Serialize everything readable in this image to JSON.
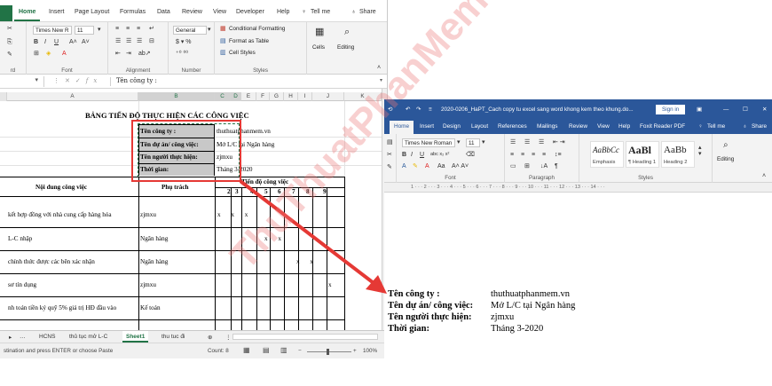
{
  "excel": {
    "tabs": [
      "Home",
      "Insert",
      "Page Layout",
      "Formulas",
      "Data",
      "Review",
      "View",
      "Developer",
      "Help"
    ],
    "tell_me": "Tell me",
    "share": "Share",
    "font_name": "Times New R",
    "font_size": "11",
    "number_format": "General",
    "groups": {
      "clipboard": "rd",
      "font": "Font",
      "alignment": "Alignment",
      "number": "Number",
      "styles": "Styles"
    },
    "styles_items": [
      "Conditional Formatting",
      "Format as Table",
      "Cell Styles"
    ],
    "cells_label": "Cells",
    "editing_label": "Editing",
    "formula_bar_text": "Tên công ty :",
    "columns": [
      "A",
      "B",
      "C",
      "D",
      "E",
      "F",
      "G",
      "H",
      "I",
      "J",
      "K"
    ],
    "sheet": {
      "title": "BẢNG TIẾN ĐỘ THỰC HIỆN CÁC CÔNG VIỆC",
      "info_labels": [
        "Tên công ty :",
        "Tên dự án/ công việc:",
        "Tên người thực hiện:",
        "Thời gian:"
      ],
      "info_values_visible": [
        "thuthuatphanmem.vn",
        "Mở L/C tại Ngân hàng",
        "zjmxu",
        "Tháng 3-2020"
      ],
      "header_content": "Nội dung công việc",
      "header_owner": "Phụ trách",
      "header_progress": "Tiến độ công việc",
      "progress_cols": [
        "2",
        "3",
        "4",
        "5",
        "6",
        "7",
        "8",
        "9"
      ],
      "rows": [
        {
          "task": "kết hợp đồng với nhà cung cấp hàng hóa",
          "owner": "zjmxu",
          "marks": "x x x"
        },
        {
          "task": "L-C  nhập",
          "owner": "Ngân hàng",
          "marks": "x x"
        },
        {
          "task": "chính thức được các bên xác nhận",
          "owner": "Ngân hàng",
          "marks": "x x"
        },
        {
          "task": "sơ tín dụng",
          "owner": "zjmxu",
          "marks": "x"
        },
        {
          "task": "nh toán tiền ký quỹ 5% giá trị HĐ đầu vào",
          "owner": "Kế toán",
          "marks": ""
        }
      ]
    },
    "sheet_tabs": [
      "HCNS",
      "thủ tục mở L-C",
      "Sheet1",
      "thu tuc đi"
    ],
    "status_text": "stination and press ENTER or choose Paste",
    "count_text": "Count: 8",
    "zoom": "100%"
  },
  "word": {
    "title": "2020-0206_HaPT_Cach copy tu excel sang word khong kem theo khung.do...",
    "sign_in": "Sign in",
    "tabs": [
      "Home",
      "Insert",
      "Design",
      "Layout",
      "References",
      "Mailings",
      "Review",
      "View",
      "Help",
      "Foxit Reader PDF"
    ],
    "tell_me": "Tell me",
    "share": "Share",
    "font_name": "Times New Roman",
    "font_size": "11",
    "groups": {
      "font": "Font",
      "paragraph": "Paragraph",
      "styles": "Styles"
    },
    "styles": [
      {
        "sample": "AaBbCc",
        "name": "Emphasis"
      },
      {
        "sample": "AaBl",
        "name": "¶ Heading 1"
      },
      {
        "sample": "AaBb",
        "name": "Heading 2"
      }
    ],
    "editing_label": "Editing",
    "ruler_text": "1 · · · 2 · · · 3 · · · 4 · · · 5 · · · 6 · · · 7 · · · 8 · · · 9 · · · 10 · · · 11 · · · 12 · · · 13 · · · 14 · · ·",
    "doc_rows": [
      {
        "label": "Tên công ty :",
        "value": "thuthuatphanmem.vn"
      },
      {
        "label": "Tên dự án/ công việc:",
        "value": "Mở L/C tại Ngân hàng"
      },
      {
        "label": "Tên người thực hiện:",
        "value": "zjmxu"
      },
      {
        "label": "Thời gian:",
        "value": "Tháng 3-2020"
      }
    ]
  },
  "watermark": "ThuThuatPhanMem",
  "colors": {
    "excel_green": "#217346",
    "word_blue": "#2b579a",
    "highlight_red": "#e53935"
  }
}
